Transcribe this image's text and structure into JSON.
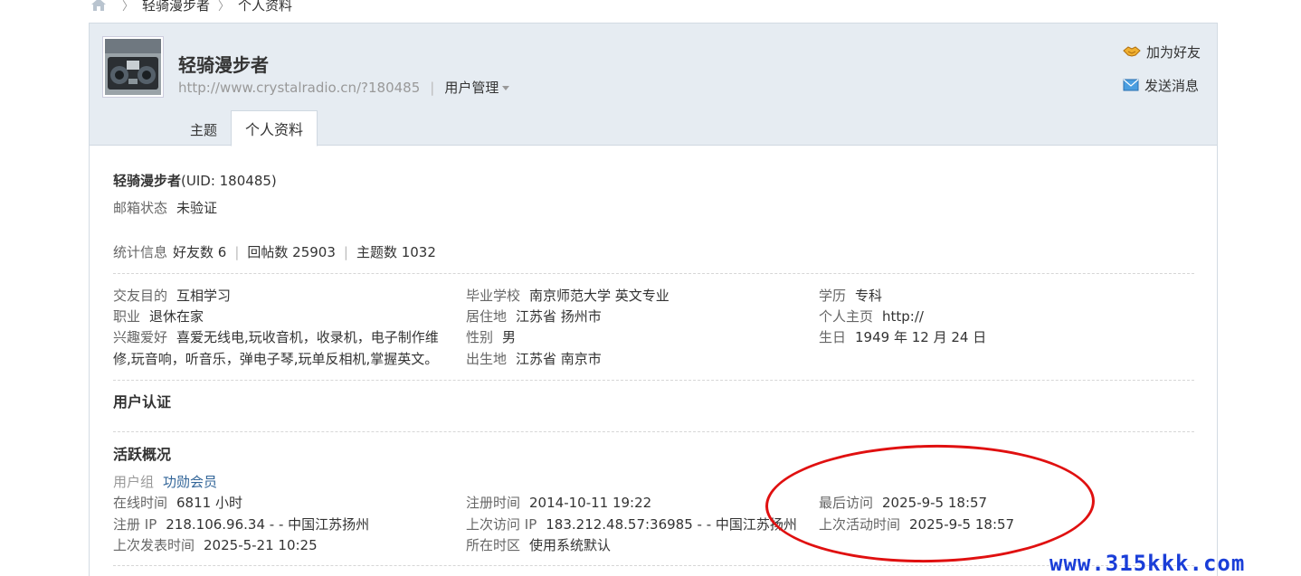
{
  "breadcrumb": {
    "items": [
      "轻骑漫步者",
      "个人资料"
    ]
  },
  "profile": {
    "name": "轻骑漫步者",
    "url": "http://www.crystalradio.cn/?180485",
    "manage_label": "用户管理",
    "add_friend": "加为好友",
    "send_message": "发送消息"
  },
  "tabs": [
    "主题",
    "个人资料"
  ],
  "info": {
    "name": "轻骑漫步者",
    "uid": "(UID: 180485)",
    "email_label": "邮箱状态",
    "email_value": "未验证",
    "stats_label": "统计信息",
    "friends": "好友数 6",
    "replies": "回帖数 25903",
    "threads": "主题数 1032"
  },
  "details": {
    "purpose_label": "交友目的",
    "purpose": "互相学习",
    "school_label": "毕业学校",
    "school": "南京师范大学 英文专业",
    "edu_label": "学历",
    "edu": "专科",
    "job_label": "职业",
    "job": "退休在家",
    "residence_label": "居住地",
    "residence": "江苏省 扬州市",
    "homepage_label": "个人主页",
    "homepage": "http://",
    "hobby_label": "兴趣爱好",
    "hobby_line1": "喜爱无线电,玩收音机，收录机，电子制作维",
    "hobby_line2": "修,玩音响，听音乐，弹电子琴,玩单反相机,掌握英文。",
    "gender_label": "性别",
    "gender": "男",
    "birthday_label": "生日",
    "birthday": "1949 年 12 月 24 日",
    "birthplace_label": "出生地",
    "birthplace": "江苏省 南京市"
  },
  "certification": {
    "title": "用户认证"
  },
  "activity": {
    "title": "活跃概况",
    "group_label": "用户组",
    "group": "功勋会员",
    "online_label": "在线时间",
    "online": "6811 小时",
    "register_label": "注册时间",
    "register": "2014-10-11 19:22",
    "last_visit_label": "最后访问",
    "last_visit": "2025-9-5 18:57",
    "reg_ip_label": "注册 IP",
    "reg_ip": "218.106.96.34 - - 中国江苏扬州",
    "last_ip_label": "上次访问 IP",
    "last_ip": "183.212.48.57:36985 - - 中国江苏扬州",
    "last_active_label": "上次活动时间",
    "last_active": "2025-9-5 18:57",
    "last_post_label": "上次发表时间",
    "last_post": "2025-5-21 10:25",
    "timezone_label": "所在时区",
    "timezone": "使用系统默认"
  },
  "watermark": "www.315kkk.com",
  "colors": {
    "accent_red": "#e01010",
    "watermark_blue": "#1a3ed8",
    "header_bg": "#e6ecf2"
  }
}
